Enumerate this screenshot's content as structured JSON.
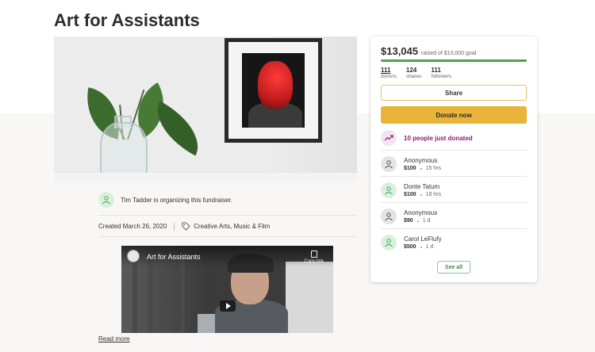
{
  "page": {
    "title": "Art for Assistants"
  },
  "organizer": {
    "text": "Tim Tadder is organizing this fundraiser."
  },
  "meta": {
    "created": "Created March 26, 2020",
    "category": "Creative Arts, Music & Film"
  },
  "video": {
    "title": "Art for Assistants",
    "copy_label": "Copy link"
  },
  "read_more": "Read more",
  "campaign": {
    "raised": "$13,045",
    "goal_text": "raised of $10,000 goal",
    "progress_fraction": 1.0,
    "stats": [
      {
        "value": "111",
        "label": "donors"
      },
      {
        "value": "124",
        "label": "shares"
      },
      {
        "value": "111",
        "label": "followers"
      }
    ],
    "share_label": "Share",
    "donate_label": "Donate now",
    "recent_text": "10 people just donated",
    "donations": [
      {
        "name": "Anonymous",
        "amount": "$100",
        "time": "15 hrs",
        "avatar": "grey"
      },
      {
        "name": "Donte Tatum",
        "amount": "$100",
        "time": "18 hrs",
        "avatar": "green"
      },
      {
        "name": "Anonymous",
        "amount": "$90",
        "time": "1 d",
        "avatar": "grey"
      },
      {
        "name": "Carol LeFlufy",
        "amount": "$500",
        "time": "1 d",
        "avatar": "green"
      }
    ],
    "see_all_label": "See all"
  },
  "colors": {
    "accent_green": "#4aa450",
    "donate_yellow": "#e9b43a",
    "recent_purple": "#8a1f74"
  }
}
